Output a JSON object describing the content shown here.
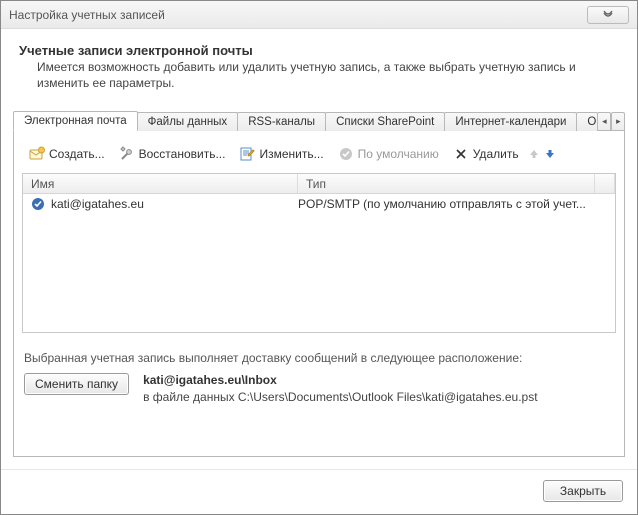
{
  "window": {
    "title": "Настройка учетных записей",
    "close_glyph": "✕"
  },
  "heading": {
    "title": "Учетные записи электронной почты",
    "description": "Имеется возможность добавить или удалить учетную запись, а также выбрать учетную запись и изменить ее параметры."
  },
  "tabs": {
    "items": [
      {
        "label": "Электронная почта"
      },
      {
        "label": "Файлы данных"
      },
      {
        "label": "RSS-каналы"
      },
      {
        "label": "Списки SharePoint"
      },
      {
        "label": "Интернет-календари"
      },
      {
        "label": "Опубликованные календари"
      }
    ],
    "left_glyph": "◂",
    "right_glyph": "▸"
  },
  "toolbar": {
    "create_label": "Создать...",
    "repair_label": "Восстановить...",
    "edit_label": "Изменить...",
    "default_label": "По умолчанию",
    "delete_label": "Удалить"
  },
  "table": {
    "headers": {
      "name": "Имя",
      "type": "Тип"
    },
    "rows": [
      {
        "name": "kati@igatahes.eu",
        "type": "POP/SMTP (по умолчанию отправлять с этой учет..."
      }
    ]
  },
  "delivery": {
    "intro": "Выбранная учетная запись выполняет доставку сообщений в следующее расположение:",
    "change_folder_label": "Сменить папку",
    "location_bold": "kati@igatahes.eu\\Inbox",
    "file_line": "в файле данных C:\\Users\\Documents\\Outlook Files\\kati@igatahes.eu.pst"
  },
  "footer": {
    "close_label": "Закрыть"
  },
  "icons": {
    "create": "new-mail-icon",
    "repair": "tools-icon",
    "edit": "edit-icon",
    "default": "check-circle-icon",
    "delete": "x-icon",
    "up": "arrow-up-icon",
    "down": "arrow-down-icon",
    "row_default": "default-account-icon"
  }
}
